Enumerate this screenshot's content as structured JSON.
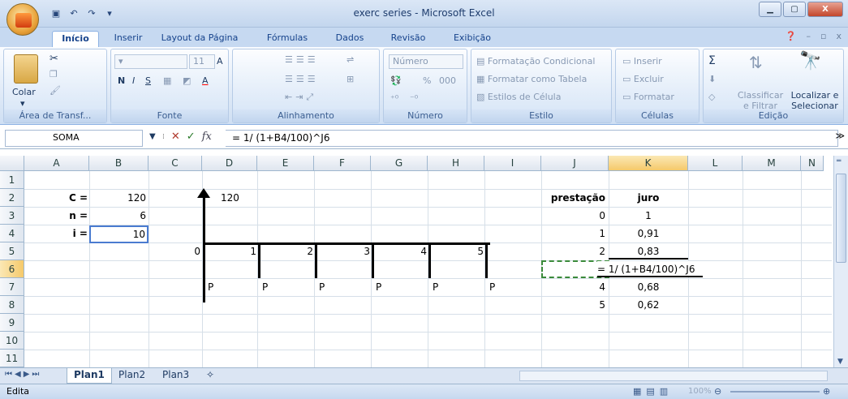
{
  "title_bar": {
    "title": "exerc series - Microsoft Excel"
  },
  "ribbon_tabs": [
    "Início",
    "Inserir",
    "Layout da Página",
    "Fórmulas",
    "Dados",
    "Revisão",
    "Exibição"
  ],
  "ribbon": {
    "clipboard": {
      "paste": "Colar",
      "group": "Área de Transf..."
    },
    "font": {
      "size": "11",
      "bold": "N",
      "italic": "I",
      "underline": "S",
      "group": "Fonte"
    },
    "alignment": {
      "group": "Alinhamento"
    },
    "number": {
      "format": "Número",
      "percent": "%",
      "thousands": "000",
      "group": "Número"
    },
    "style": {
      "conditional": "Formatação Condicional",
      "table": "Formatar como Tabela",
      "cell": "Estilos de Célula",
      "group": "Estilo"
    },
    "cells": {
      "insert": "Inserir",
      "delete": "Excluir",
      "format": "Formatar",
      "group": "Células"
    },
    "editing": {
      "sort_line1": "Classificar",
      "sort_line2": "e Filtrar",
      "find_line1": "Localizar e",
      "find_line2": "Selecionar",
      "group": "Edição"
    }
  },
  "formula_bar": {
    "name_box": "SOMA",
    "fx": "fx",
    "formula": "= 1/ (1+B4/100)^J6"
  },
  "columns": [
    "A",
    "B",
    "C",
    "D",
    "E",
    "F",
    "G",
    "H",
    "I",
    "J",
    "K",
    "L",
    "M",
    "N"
  ],
  "rows": [
    "1",
    "2",
    "3",
    "4",
    "5",
    "6",
    "7",
    "8",
    "9",
    "10",
    "11"
  ],
  "cells": {
    "A2": "C =",
    "B2": "120",
    "A3": "n =",
    "B3": "6",
    "A4": "i =",
    "B4": "10",
    "D2": "120",
    "timeline_ticks": [
      "0",
      "1",
      "2",
      "3",
      "4",
      "5"
    ],
    "payments": [
      "P",
      "P",
      "P",
      "P",
      "P",
      "P"
    ],
    "J2": "prestação",
    "K2": "juro",
    "J3": "0",
    "K3": "1",
    "J4": "1",
    "K4": "0,91",
    "J5": "2",
    "K5": "0,83",
    "K6": "= 1/ (1+B4/100)^J6",
    "J7": "4",
    "K7": "0,68",
    "J8": "5",
    "K8": "0,62"
  },
  "sheets": [
    "Plan1",
    "Plan2",
    "Plan3"
  ],
  "status": {
    "mode": "Edita",
    "zoom": "100%"
  }
}
